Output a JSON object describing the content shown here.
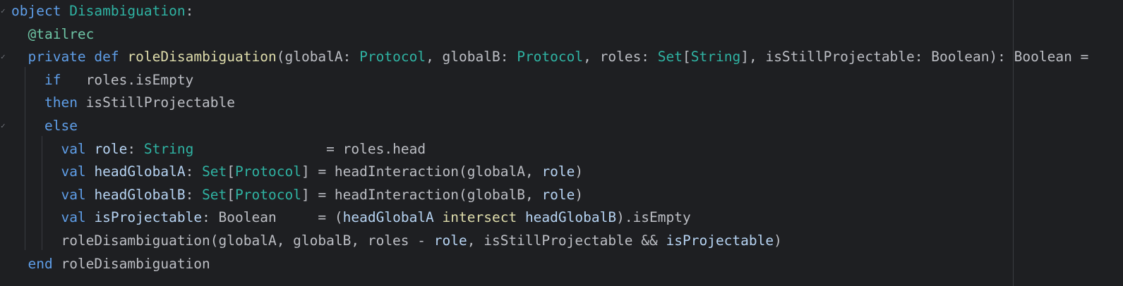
{
  "editor": {
    "language": "Scala",
    "fold_icon": "fold-check-icon",
    "lines": [
      {
        "indent": "",
        "tokens": [
          {
            "t": "object",
            "k": "kw"
          },
          {
            "t": " ",
            "k": "pl"
          },
          {
            "t": "Disambiguation",
            "k": "ty"
          },
          {
            "t": ":",
            "k": "pl"
          }
        ]
      },
      {
        "indent": "  ",
        "tokens": [
          {
            "t": "@tailrec",
            "k": "an"
          }
        ]
      },
      {
        "indent": "  ",
        "tokens": [
          {
            "t": "private",
            "k": "kw"
          },
          {
            "t": " ",
            "k": "pl"
          },
          {
            "t": "def",
            "k": "kw"
          },
          {
            "t": " ",
            "k": "pl"
          },
          {
            "t": "roleDisambiguation",
            "k": "fn"
          },
          {
            "t": "(globalA: ",
            "k": "pl"
          },
          {
            "t": "Protocol",
            "k": "ty"
          },
          {
            "t": ", globalB: ",
            "k": "pl"
          },
          {
            "t": "Protocol",
            "k": "ty"
          },
          {
            "t": ", roles: ",
            "k": "pl"
          },
          {
            "t": "Set",
            "k": "ty"
          },
          {
            "t": "[",
            "k": "pl"
          },
          {
            "t": "String",
            "k": "ty"
          },
          {
            "t": "], isStillProjectable: Boolean): Boolean =",
            "k": "pl"
          }
        ]
      },
      {
        "indent": "    ",
        "tokens": [
          {
            "t": "if",
            "k": "kw"
          },
          {
            "t": "   roles.isEmpty",
            "k": "pl"
          }
        ]
      },
      {
        "indent": "    ",
        "tokens": [
          {
            "t": "then",
            "k": "kw"
          },
          {
            "t": " isStillProjectable",
            "k": "pl"
          }
        ]
      },
      {
        "indent": "    ",
        "tokens": [
          {
            "t": "else",
            "k": "kw"
          }
        ]
      },
      {
        "indent": "      ",
        "tokens": [
          {
            "t": "val",
            "k": "kw"
          },
          {
            "t": " ",
            "k": "pl"
          },
          {
            "t": "role",
            "k": "lv"
          },
          {
            "t": ": ",
            "k": "pl"
          },
          {
            "t": "String",
            "k": "ty"
          },
          {
            "t": "                = roles.head",
            "k": "pl"
          }
        ]
      },
      {
        "indent": "      ",
        "tokens": [
          {
            "t": "val",
            "k": "kw"
          },
          {
            "t": " ",
            "k": "pl"
          },
          {
            "t": "headGlobalA",
            "k": "lv"
          },
          {
            "t": ": ",
            "k": "pl"
          },
          {
            "t": "Set",
            "k": "ty"
          },
          {
            "t": "[",
            "k": "pl"
          },
          {
            "t": "Protocol",
            "k": "ty"
          },
          {
            "t": "] = headInteraction(globalA, ",
            "k": "pl"
          },
          {
            "t": "role",
            "k": "lv"
          },
          {
            "t": ")",
            "k": "pl"
          }
        ]
      },
      {
        "indent": "      ",
        "tokens": [
          {
            "t": "val",
            "k": "kw"
          },
          {
            "t": " ",
            "k": "pl"
          },
          {
            "t": "headGlobalB",
            "k": "lv"
          },
          {
            "t": ": ",
            "k": "pl"
          },
          {
            "t": "Set",
            "k": "ty"
          },
          {
            "t": "[",
            "k": "pl"
          },
          {
            "t": "Protocol",
            "k": "ty"
          },
          {
            "t": "] = headInteraction(globalB, ",
            "k": "pl"
          },
          {
            "t": "role",
            "k": "lv"
          },
          {
            "t": ")",
            "k": "pl"
          }
        ]
      },
      {
        "indent": "      ",
        "tokens": [
          {
            "t": "val",
            "k": "kw"
          },
          {
            "t": " ",
            "k": "pl"
          },
          {
            "t": "isProjectable",
            "k": "lv"
          },
          {
            "t": ": Boolean     = (",
            "k": "pl"
          },
          {
            "t": "headGlobalA",
            "k": "lv"
          },
          {
            "t": " intersect ",
            "k": "fn"
          },
          {
            "t": "headGlobalB",
            "k": "lv"
          },
          {
            "t": ").isEmpty",
            "k": "pl"
          }
        ]
      },
      {
        "indent": "      ",
        "tokens": [
          {
            "t": "roleDisambiguation(globalA, globalB, roles - ",
            "k": "pl"
          },
          {
            "t": "role",
            "k": "lv"
          },
          {
            "t": ", isStillProjectable && ",
            "k": "pl"
          },
          {
            "t": "isProjectable",
            "k": "lv"
          },
          {
            "t": ")",
            "k": "pl"
          }
        ]
      },
      {
        "indent": "  ",
        "tokens": [
          {
            "t": "end",
            "k": "kw"
          },
          {
            "t": " roleDisambiguation",
            "k": "pl"
          }
        ]
      }
    ]
  }
}
